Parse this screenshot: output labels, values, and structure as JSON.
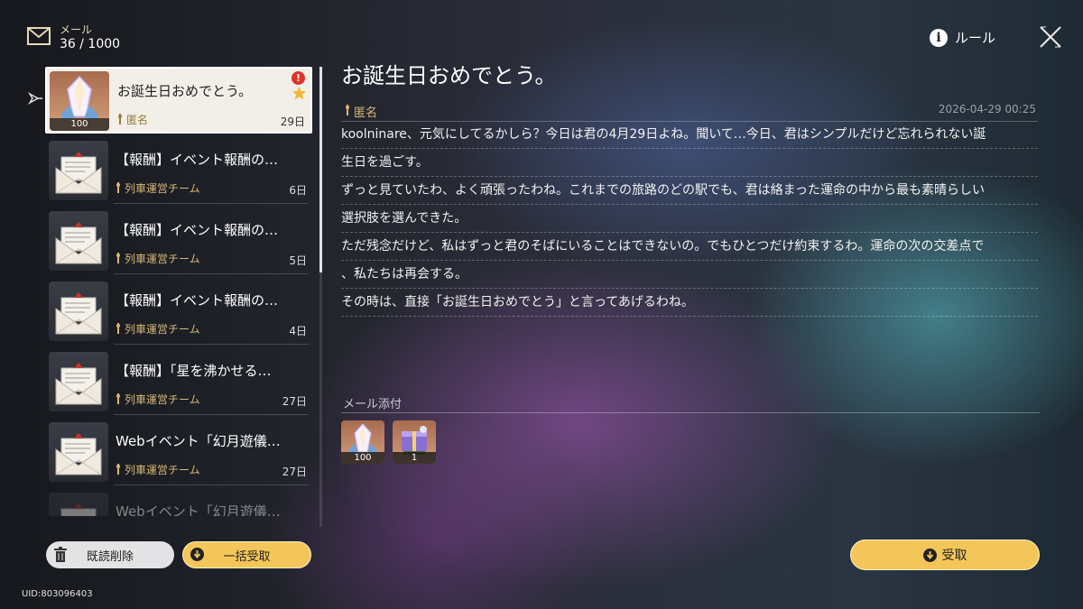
{
  "header": {
    "mail_label": "メール",
    "mail_count": "36 / 1000",
    "rule_label": "ルール"
  },
  "mail_list": [
    {
      "title": "お誕生日おめでとう。",
      "sender": "匿名",
      "date": "29日",
      "attachment_count": "100",
      "selected": true,
      "unread_alert": "!",
      "starred": true
    },
    {
      "title": "【報酬】イベント報酬の…",
      "sender": "列車運営チーム",
      "date": "6日"
    },
    {
      "title": "【報酬】イベント報酬の…",
      "sender": "列車運営チーム",
      "date": "5日"
    },
    {
      "title": "【報酬】イベント報酬の…",
      "sender": "列車運営チーム",
      "date": "4日"
    },
    {
      "title": "【報酬】「星を沸かせる…",
      "sender": "列車運営チーム",
      "date": "27日"
    },
    {
      "title": "Webイベント「幻月遊儀…",
      "sender": "列車運営チーム",
      "date": "27日"
    },
    {
      "title": "Webイベント「幻月遊儀…",
      "sender": "",
      "date": ""
    }
  ],
  "buttons": {
    "delete_read": "既読削除",
    "claim_all": "一括受取",
    "claim": "受取"
  },
  "uid": "UID:803096403",
  "detail": {
    "title": "お誕生日おめでとう。",
    "sender": "匿名",
    "datetime": "2026-04-29 00:25",
    "body_lines": [
      "koolninare、元気にしてるかしら？今日は君の4月29日よね。聞いて…今日、君はシンプルだけど忘れられない誕",
      "生日を過ごす。",
      "ずっと見ていたわ、よく頑張ったわね。これまでの旅路のどの駅でも、君は絡まった運命の中から最も素晴らしい",
      "選択肢を選んできた。",
      "ただ残念だけど、私はずっと君のそばにいることはできないの。でもひとつだけ約束するわ。運命の次の交差点で",
      "、私たちは再会する。",
      "その時は、直接「お誕生日おめでとう」と言ってあげるわね。"
    ],
    "attachments_label": "メール添付",
    "attachments": [
      {
        "name": "crystal-item",
        "qty": "100"
      },
      {
        "name": "gift-box-item",
        "qty": "1"
      }
    ]
  },
  "colors": {
    "accent_gold": "#f4c659",
    "sender_gold": "#d8b775",
    "alert_red": "#e0322b"
  }
}
